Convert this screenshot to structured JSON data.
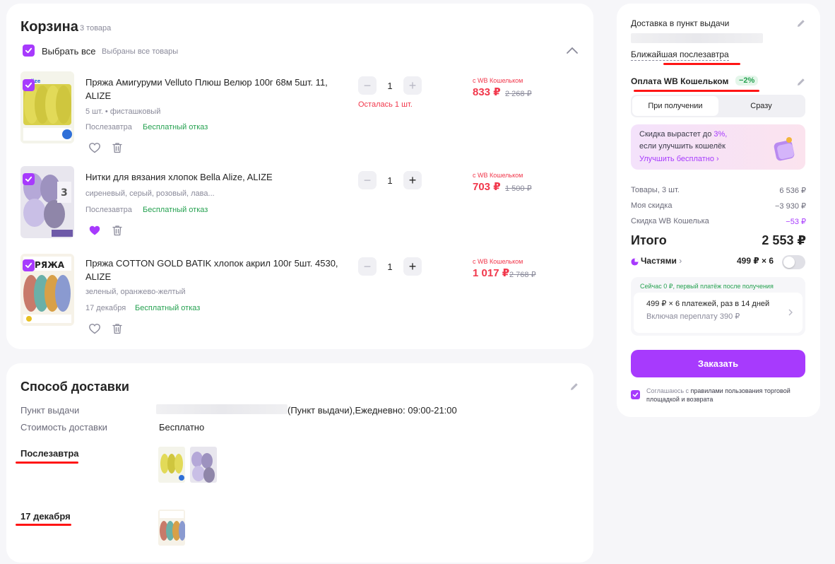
{
  "cart": {
    "title": "Корзина",
    "count": "3 товара",
    "select_all": "Выбрать все",
    "select_note": "Выбраны все товары",
    "items": [
      {
        "title": "Пряжа Амигуруми Velluto Плюш Велюр 100г 68м 5шт. 11, ALIZE",
        "attrs": "5 шт. • фисташковый",
        "date": "Послезавтра",
        "free": "Бесплатный отказ",
        "qty": "1",
        "left": "Осталась 1 шт.",
        "wallet": "с WB Кошельком",
        "price": "833 ₽",
        "old_price": "2 268 ₽",
        "liked": false,
        "thumb_color": "#d8d04a"
      },
      {
        "title": "Нитки для вязания хлопок Bella Alize, ALIZE",
        "attrs": "сиреневый, серый, розовый, лава...",
        "date": "Послезавтра",
        "free": "Бесплатный отказ",
        "qty": "1",
        "wallet": "с WB Кошельком",
        "price": "703 ₽",
        "old_price": "1 500 ₽",
        "liked": true,
        "thumb_color": "#a89cc8"
      },
      {
        "title": "Пряжа COTTON GOLD BATIK хлопок акрил 100г 5шт. 4530, ALIZE",
        "attrs": "зеленый, оранжево-желтый",
        "date": "17 декабря",
        "free": "Бесплатный отказ",
        "qty": "1",
        "wallet": "с WB Кошельком",
        "price": "1 017 ₽",
        "old_price": "2 768 ₽",
        "liked": false,
        "thumb_color": "#c87a6a"
      }
    ]
  },
  "delivery": {
    "title": "Способ доставки",
    "point_label": "Пункт выдачи",
    "point_value": "(Пункт выдачи),Ежедневно: 09:00-21:00",
    "cost_label": "Стоимость доставки",
    "cost_value": "Бесплатно",
    "groups": [
      {
        "date": "Послезавтра"
      },
      {
        "date": "17 декабря"
      }
    ]
  },
  "summary": {
    "delivery_title": "Доставка в пункт выдачи",
    "nearest": "Ближайшая послезавтра",
    "payment_title": "Оплата WB Кошельком",
    "payment_discount": "−2%",
    "pay_on_receipt": "При получении",
    "pay_now": "Сразу",
    "promo_line1": "Скидка вырастет до",
    "promo_pct": "3%,",
    "promo_line2": "если улучшить кошелёк",
    "promo_link": "Улучшить бесплатно",
    "goods_label": "Товары, 3 шт.",
    "goods_value": "6 536 ₽",
    "discount_label": "Моя скидка",
    "discount_value": "−3 930 ₽",
    "wallet_label": "Скидка WB Кошелька",
    "wallet_value": "−53 ₽",
    "total_label": "Итого",
    "total_value": "2 553 ₽",
    "parts_label": "Частями",
    "parts_value": "499 ₽ × 6",
    "parts_note": "Сейчас 0 ₽, первый платёж после получения",
    "parts_line1": "499 ₽ × 6 платежей, раз в 14 дней",
    "parts_line2": "Включая переплату 390 ₽",
    "order_button": "Заказать",
    "agree_prefix": "Соглашаюсь с",
    "agree_link": "правилами пользования торговой площадкой и возврата"
  },
  "colors": {
    "accent": "#a73afd",
    "price_red": "#f1374b",
    "green": "#25a150",
    "annotation_red": "#ff1515"
  }
}
